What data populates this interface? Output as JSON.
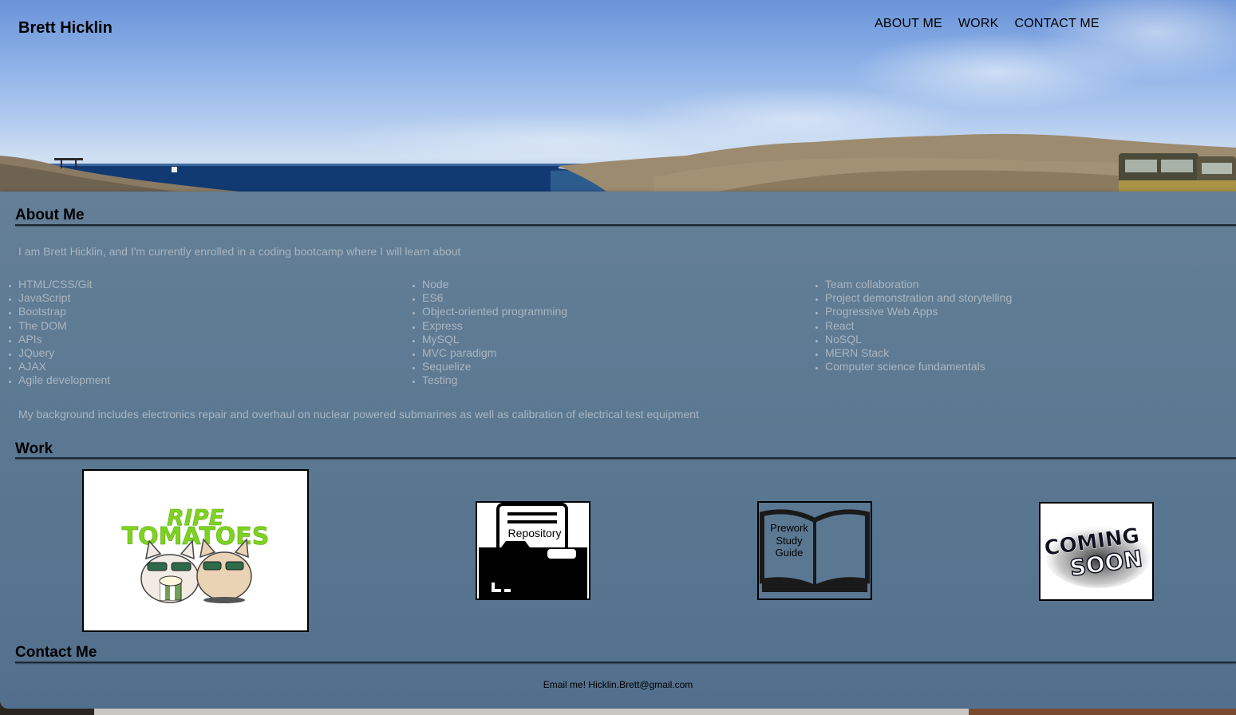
{
  "header": {
    "brand": "Brett Hicklin",
    "nav": [
      "ABOUT ME",
      "WORK",
      "CONTACT ME"
    ]
  },
  "about": {
    "title": "About Me",
    "intro": "I am Brett Hicklin, and I'm currently enrolled in a coding bootcamp where I will learn about",
    "columns": [
      [
        "HTML/CSS/Git",
        "JavaScript",
        "Bootstrap",
        "The DOM",
        "APIs",
        "JQuery",
        "AJAX",
        "Agile development"
      ],
      [
        "Node",
        "ES6",
        "Object-oriented programming",
        "Express",
        "MySQL",
        "MVC paradigm",
        "Sequelize",
        "Testing"
      ],
      [
        "Team collaboration",
        "Project demonstration and storytelling",
        "Progressive Web Apps",
        "React",
        "NoSQL",
        "MERN Stack",
        "Computer science fundamentals"
      ]
    ],
    "background": "My background includes electronics repair and overhaul on nuclear powered submarines as well as calibration of electrical test equipment"
  },
  "work": {
    "title": "Work",
    "items": [
      {
        "logo_line1": "RIPE",
        "logo_line2": "TOMATOES"
      },
      {
        "label": "Repository"
      },
      {
        "label_lines": [
          "Prework",
          "Study",
          "Guide"
        ]
      },
      {
        "line1": "COMING",
        "line2": "SOON"
      }
    ]
  },
  "contact": {
    "title": "Contact Me",
    "email_text": "Email me! Hicklin.Brett@gmail.com"
  },
  "colors": {
    "panel": "#5b7892",
    "muted_text": "#a9b5c0",
    "logo_green": "#7ed321"
  }
}
